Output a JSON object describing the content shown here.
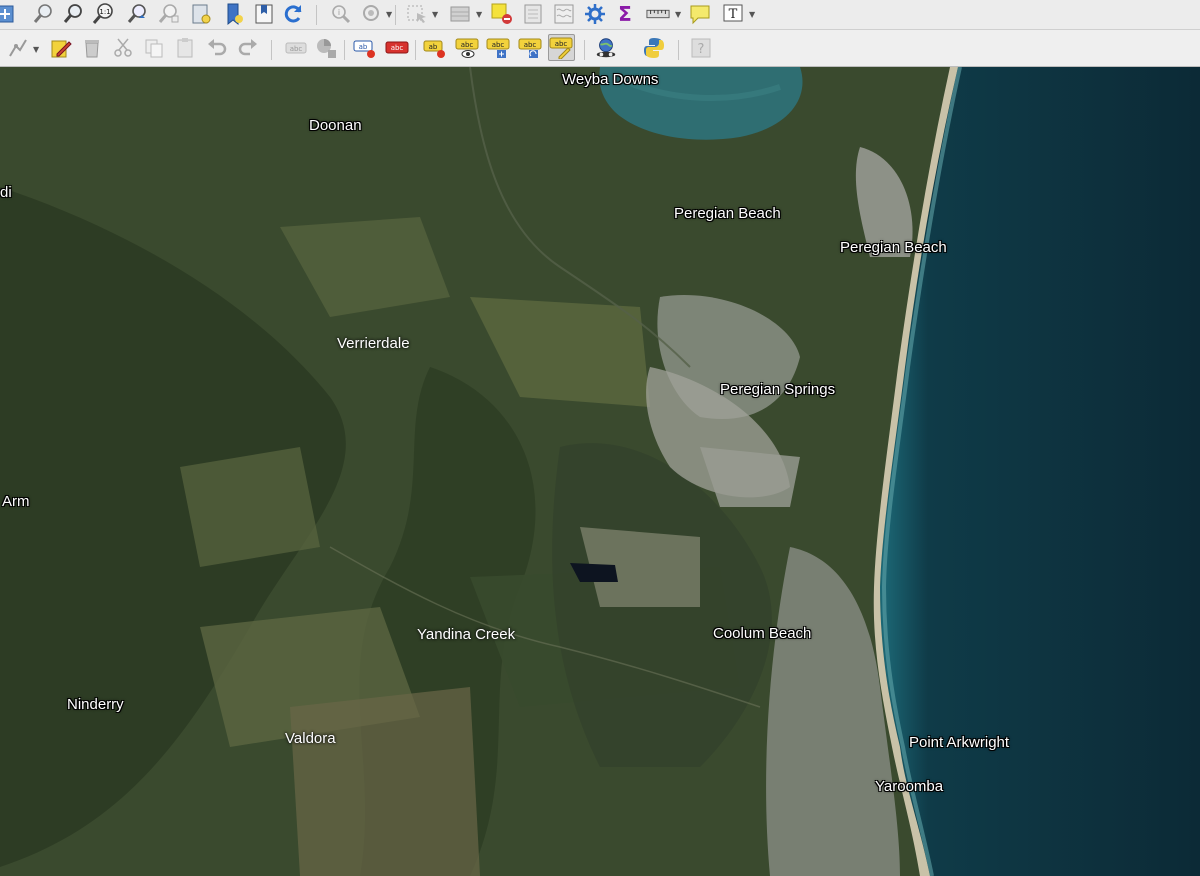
{
  "app": {
    "toolbars": {
      "map_navigation": [
        {
          "name": "pan-map-to-selection-icon"
        },
        {
          "name": "zoom-in-icon"
        },
        {
          "name": "zoom-out-icon"
        },
        {
          "name": "zoom-native-resolution-icon",
          "text": "1:1"
        },
        {
          "name": "zoom-last-icon"
        },
        {
          "name": "zoom-next-icon"
        },
        {
          "name": "new-map-view-icon"
        },
        {
          "name": "new-bookmark-icon"
        },
        {
          "name": "show-bookmarks-icon"
        },
        {
          "name": "refresh-icon"
        }
      ],
      "attributes": [
        {
          "name": "identify-features-icon"
        },
        {
          "name": "run-feature-action-icon"
        },
        {
          "name": "select-features-icon"
        },
        {
          "name": "open-attribute-table-icon"
        },
        {
          "name": "deselect-all-icon"
        },
        {
          "name": "field-calculator-icon"
        },
        {
          "name": "statistical-summary-icon"
        },
        {
          "name": "toolbox-gear-icon"
        },
        {
          "name": "sigma-icon",
          "text": "Σ"
        },
        {
          "name": "measure-line-icon"
        },
        {
          "name": "map-tips-icon"
        },
        {
          "name": "text-annotation-icon",
          "text": "T"
        }
      ],
      "digitizing": [
        {
          "name": "digitize-with-segment-icon"
        },
        {
          "name": "toggle-editing-pencil-icon"
        },
        {
          "name": "delete-selected-icon"
        },
        {
          "name": "cut-features-icon"
        },
        {
          "name": "copy-features-icon"
        },
        {
          "name": "paste-features-icon"
        },
        {
          "name": "undo-icon"
        },
        {
          "name": "redo-icon"
        }
      ],
      "labels": [
        {
          "name": "layer-labeling-options-icon",
          "text": "abc"
        },
        {
          "name": "layer-diagram-options-icon"
        },
        {
          "name": "highlight-pinned-labels-icon",
          "text": "ab"
        },
        {
          "name": "toggle-display-unplaced-labels-icon",
          "text": "abc"
        },
        {
          "name": "pin-unpin-labels-icon",
          "text": "ab"
        },
        {
          "name": "show-hide-labels-icon",
          "text": "abc"
        },
        {
          "name": "move-label-icon",
          "text": "abc"
        },
        {
          "name": "rotate-label-icon",
          "text": "abc"
        },
        {
          "name": "change-label-icon",
          "text": "abc"
        }
      ],
      "plugins": [
        {
          "name": "openlayers-globe-icon"
        },
        {
          "name": "python-console-icon"
        },
        {
          "name": "help-whats-this-icon",
          "text": "?"
        }
      ]
    }
  },
  "map": {
    "labels": [
      {
        "text": "Weyba Downs"
      },
      {
        "text": "Doonan"
      },
      {
        "text": "di"
      },
      {
        "text": "Peregian Beach"
      },
      {
        "text": "Peregian Beach"
      },
      {
        "text": "Verrierdale"
      },
      {
        "text": "Peregian Springs"
      },
      {
        "text": "Arm"
      },
      {
        "text": "Yandina Creek"
      },
      {
        "text": "Coolum Beach"
      },
      {
        "text": "Ninderry"
      },
      {
        "text": "Valdora"
      },
      {
        "text": "Point Arkwright"
      },
      {
        "text": "Yaroomba"
      }
    ],
    "colors": {
      "ocean": "#0c2a36",
      "shallow_water": "#2f6e72",
      "beach": "#c9c2a8",
      "forest": "#2e3d25",
      "farmland": "#5b6442",
      "suburb": "#9a9c94"
    }
  }
}
